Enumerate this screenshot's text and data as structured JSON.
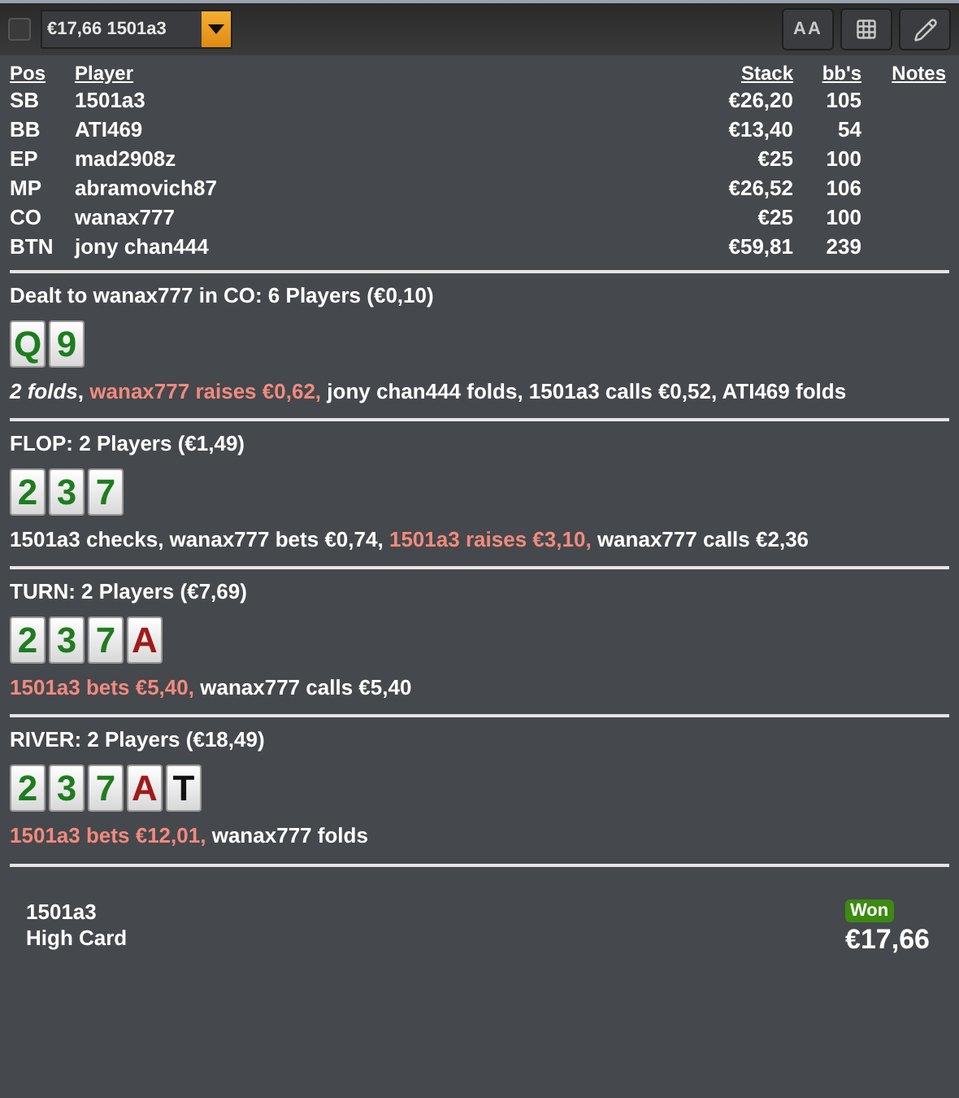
{
  "toolbar": {
    "checkbox": {
      "checked": false
    },
    "hand_select": {
      "value": "€17,66 1501a3"
    },
    "buttons": [
      {
        "kind": "font-size",
        "label": "AA"
      },
      {
        "kind": "grid"
      },
      {
        "kind": "edit"
      }
    ]
  },
  "players_table": {
    "columns": [
      "Pos",
      "Player",
      "Stack",
      "bb's",
      "Notes"
    ],
    "rows": [
      {
        "pos": "SB",
        "player": "1501a3",
        "stack": "€26,20",
        "bbs": "105"
      },
      {
        "pos": "BB",
        "player": "ATI469",
        "stack": "€13,40",
        "bbs": "54"
      },
      {
        "pos": "EP",
        "player": "mad2908z",
        "stack": "€25",
        "bbs": "100"
      },
      {
        "pos": "MP",
        "player": "abramovich87",
        "stack": "€26,52",
        "bbs": "106"
      },
      {
        "pos": "CO",
        "player": "wanax777",
        "stack": "€25",
        "bbs": "100"
      },
      {
        "pos": "BTN",
        "player": "jony chan444",
        "stack": "€59,81",
        "bbs": "239"
      }
    ]
  },
  "streets": [
    {
      "title": "Dealt to wanax777 in CO: 6 Players (€0,10)",
      "cards": [
        {
          "rank": "Q",
          "color": "#1e7d1e"
        },
        {
          "rank": "9",
          "color": "#1e7d1e"
        }
      ],
      "actions": [
        {
          "text": "*2 folds*,",
          "kind": "plain"
        },
        {
          "text": "wanax777 raises €0,62,",
          "kind": "aggressive"
        },
        {
          "text": "jony chan444 folds, 1501a3 calls €0,52, ATI469 folds",
          "kind": "plain"
        }
      ]
    },
    {
      "title": "FLOP: 2 Players (€1,49)",
      "cards": [
        {
          "rank": "2",
          "color": "#1e7d1e"
        },
        {
          "rank": "3",
          "color": "#1e7d1e"
        },
        {
          "rank": "7",
          "color": "#1e7d1e"
        }
      ],
      "actions": [
        {
          "text": "1501a3 checks, wanax777 bets €0,74,",
          "kind": "plain"
        },
        {
          "text": "1501a3 raises €3,10,",
          "kind": "aggressive"
        },
        {
          "text": "wanax777 calls €2,36",
          "kind": "plain"
        }
      ]
    },
    {
      "title": "TURN: 2 Players (€7,69)",
      "cards": [
        {
          "rank": "2",
          "color": "#1e7d1e"
        },
        {
          "rank": "3",
          "color": "#1e7d1e"
        },
        {
          "rank": "7",
          "color": "#1e7d1e"
        },
        {
          "rank": "A",
          "color": "#a01a1a"
        }
      ],
      "actions": [
        {
          "text": "1501a3 bets €5,40,",
          "kind": "aggressive"
        },
        {
          "text": "wanax777 calls €5,40",
          "kind": "plain"
        }
      ]
    },
    {
      "title": "RIVER: 2 Players (€18,49)",
      "cards": [
        {
          "rank": "2",
          "color": "#1e7d1e"
        },
        {
          "rank": "3",
          "color": "#1e7d1e"
        },
        {
          "rank": "7",
          "color": "#1e7d1e"
        },
        {
          "rank": "A",
          "color": "#a01a1a"
        },
        {
          "rank": "T",
          "color": "#111111"
        }
      ],
      "actions": [
        {
          "text": "1501a3 bets €12,01,",
          "kind": "aggressive"
        },
        {
          "text": "wanax777 folds",
          "kind": "plain"
        }
      ]
    }
  ],
  "result": {
    "player": "1501a3",
    "hand": "High Card",
    "badge": "Won",
    "amount": "€17,66"
  }
}
